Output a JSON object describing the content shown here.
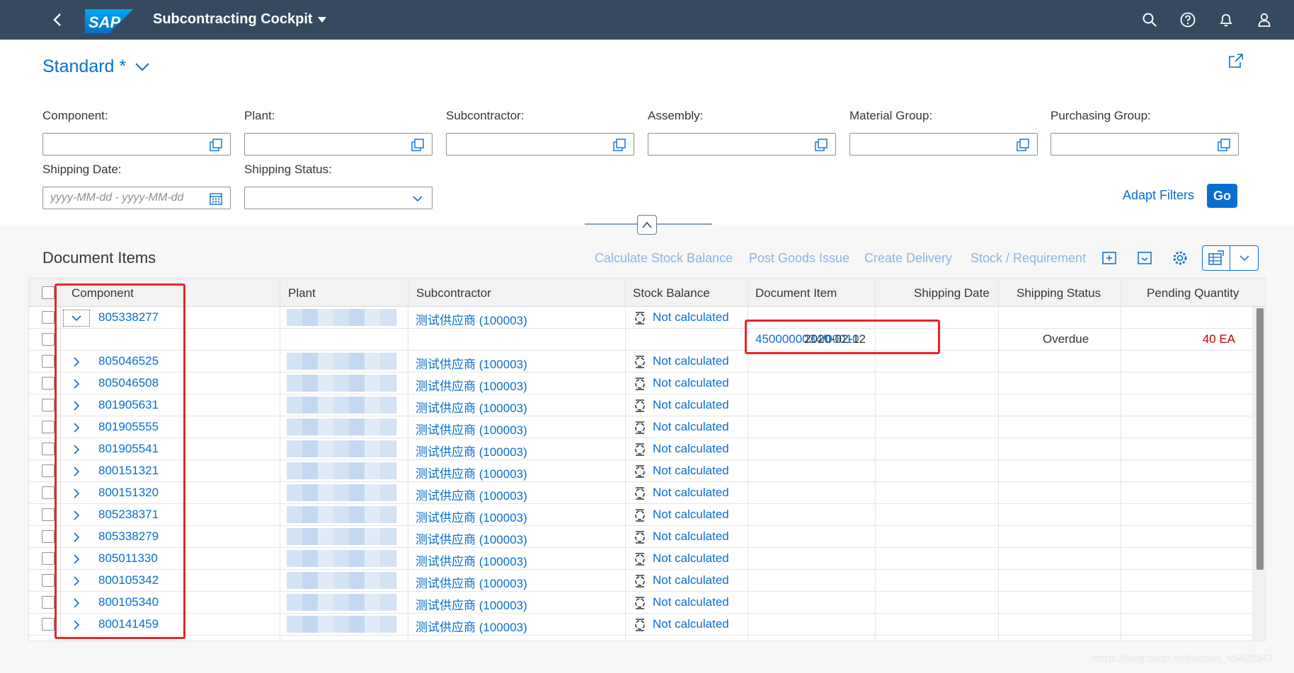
{
  "shell": {
    "title": "Subcontracting Cockpit",
    "logo_text": "SAP",
    "icons": [
      "back-icon",
      "search-icon",
      "help-icon",
      "notification-icon",
      "user-icon"
    ]
  },
  "header": {
    "variant": "Standard *",
    "filters": [
      {
        "label": "Component:",
        "value": ""
      },
      {
        "label": "Plant:",
        "value": ""
      },
      {
        "label": "Subcontractor:",
        "value": ""
      },
      {
        "label": "Assembly:",
        "value": ""
      },
      {
        "label": "Material Group:",
        "value": ""
      },
      {
        "label": "Purchasing Group:",
        "value": ""
      }
    ],
    "shipping_date": {
      "label": "Shipping Date:",
      "placeholder": "yyyy-MM-dd - yyyy-MM-dd"
    },
    "shipping_status": {
      "label": "Shipping Status:",
      "value": ""
    },
    "adapt_filters": "Adapt Filters",
    "go": "Go"
  },
  "table": {
    "title": "Document Items",
    "toolbar": [
      "Calculate Stock Balance",
      "Post Goods Issue",
      "Create Delivery",
      "Stock / Requirement"
    ],
    "columns": [
      "Component",
      "Plant",
      "Subcontractor",
      "Stock Balance",
      "Document Item",
      "Shipping Date",
      "Shipping Status",
      "Pending Quantity"
    ],
    "rows": [
      {
        "component": "805338277",
        "subcontractor": "测试供应商 (100003)",
        "stock": "Not calculated",
        "expanded": true
      },
      {
        "component": "",
        "subcontractor": "",
        "stock": "",
        "doc_item": "4500000034/00010",
        "ship_date": "2020-02-12",
        "ship_status": "Overdue",
        "pending_qty": "40 EA",
        "child": true
      },
      {
        "component": "805046525",
        "subcontractor": "测试供应商 (100003)",
        "stock": "Not calculated"
      },
      {
        "component": "805046508",
        "subcontractor": "测试供应商 (100003)",
        "stock": "Not calculated"
      },
      {
        "component": "801905631",
        "subcontractor": "测试供应商 (100003)",
        "stock": "Not calculated"
      },
      {
        "component": "801905555",
        "subcontractor": "测试供应商 (100003)",
        "stock": "Not calculated"
      },
      {
        "component": "801905541",
        "subcontractor": "测试供应商 (100003)",
        "stock": "Not calculated"
      },
      {
        "component": "800151321",
        "subcontractor": "测试供应商 (100003)",
        "stock": "Not calculated"
      },
      {
        "component": "800151320",
        "subcontractor": "测试供应商 (100003)",
        "stock": "Not calculated"
      },
      {
        "component": "805238371",
        "subcontractor": "测试供应商 (100003)",
        "stock": "Not calculated"
      },
      {
        "component": "805338279",
        "subcontractor": "测试供应商 (100003)",
        "stock": "Not calculated"
      },
      {
        "component": "805011330",
        "subcontractor": "测试供应商 (100003)",
        "stock": "Not calculated"
      },
      {
        "component": "800105342",
        "subcontractor": "测试供应商 (100003)",
        "stock": "Not calculated"
      },
      {
        "component": "800105340",
        "subcontractor": "测试供应商 (100003)",
        "stock": "Not calculated"
      },
      {
        "component": "800141459",
        "subcontractor": "测试供应商 (100003)",
        "stock": "Not calculated"
      }
    ]
  },
  "colors": {
    "shell": "#354a5f",
    "link": "#0a6ed1",
    "highlight": "#e8252a",
    "negative": "#bb0000"
  },
  "watermark": "https://blog.csdn.net/weixin_45423347"
}
